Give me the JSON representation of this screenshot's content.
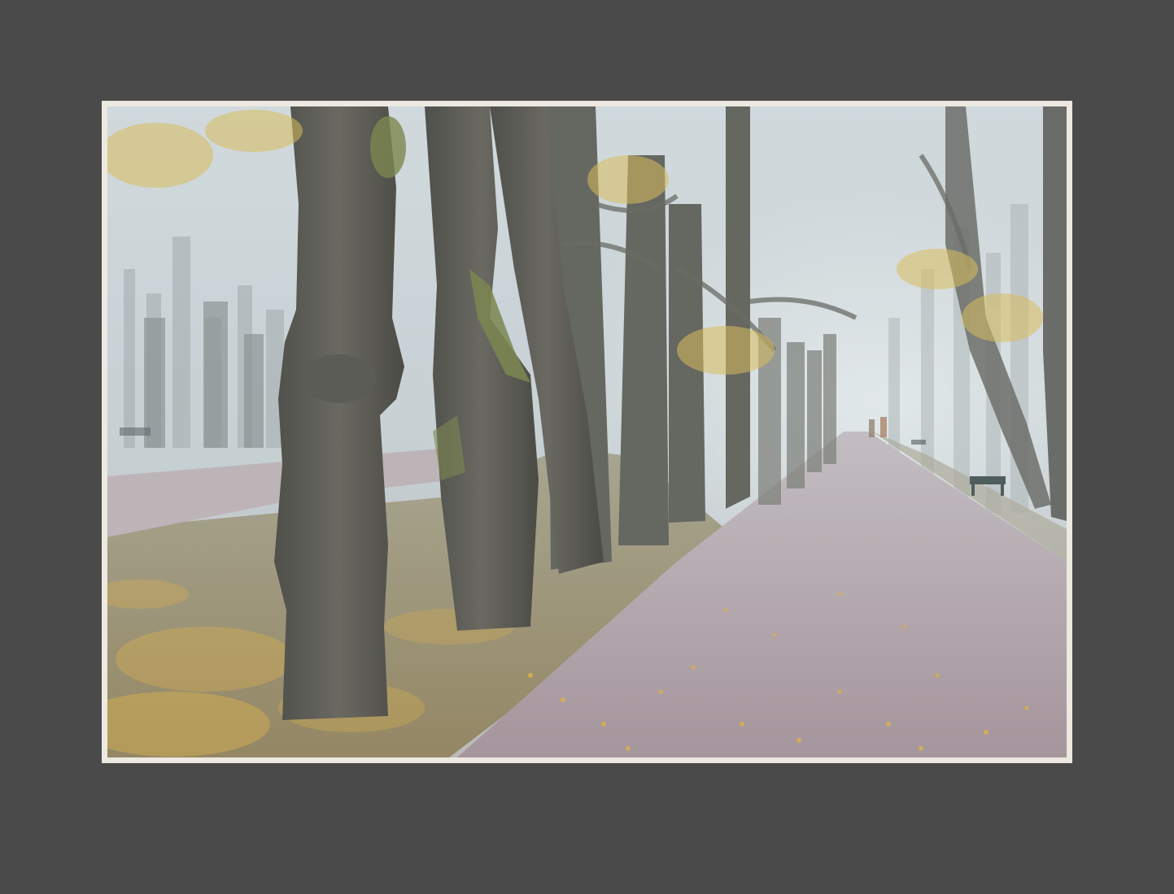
{
  "scene": {
    "subject": "misty-autumn-park-alley",
    "colors": {
      "mat": "#4a4a4a",
      "frame": "#ece9e0",
      "fog": "#c9d2d6",
      "path": "#b39fa8",
      "trunk": "#4b4a44",
      "moss": "#6f7a3c",
      "leaves": "#d9a93a",
      "lawn": "#8d8c6c"
    }
  }
}
